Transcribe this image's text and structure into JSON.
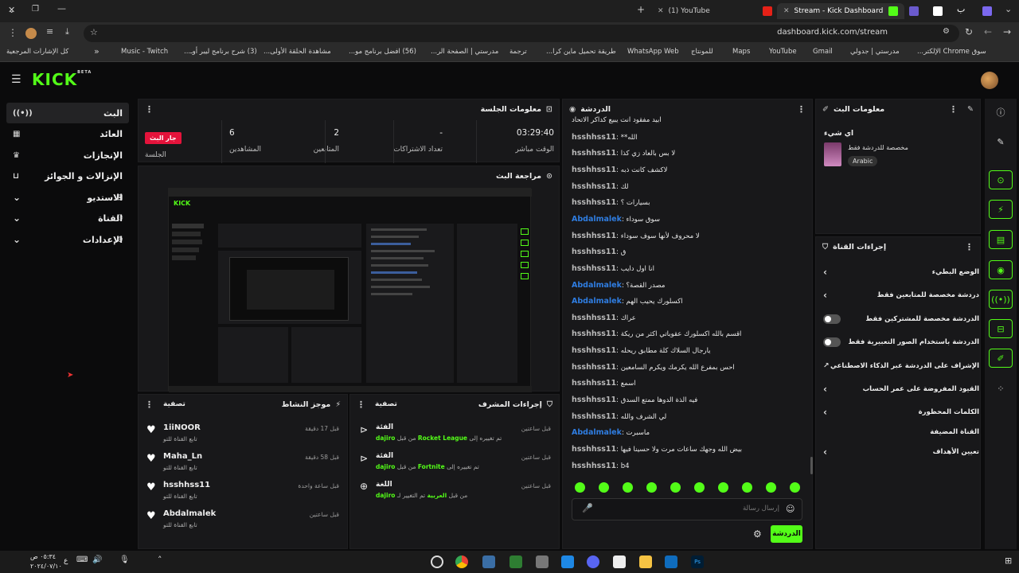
{
  "browser": {
    "tabs": [
      {
        "label": "(1) YouTube",
        "favicon": "youtube-icon"
      },
      {
        "label": "Stream - Kick Dashboard",
        "favicon": "kick-icon"
      }
    ],
    "url": "dashboard.kick.com/stream",
    "bookmarks": [
      "كل الإشارات المرجعية",
      "Music - Twitch",
      "(3) شرح برنامج ليبر أوـ...",
      "مشاهدة الحلقة الأولى...",
      "(56) افضل برنامج مو...",
      "مدرستي | الصفحة الر...",
      "ترجمة",
      "طريقة تحميل ماين كرا...",
      "WhatsApp Web",
      "للمونتاج",
      "Maps",
      "YouTube",
      "Gmail",
      "مدرستي | جدولي",
      "سوق Chrome الإلكتر..."
    ]
  },
  "brand": {
    "logo": "KICK",
    "beta": "BETA",
    "accent": "#53fc18"
  },
  "nav": [
    {
      "label": "البث",
      "icon": "broadcast-icon"
    },
    {
      "label": "العائد",
      "icon": "calendar-icon"
    },
    {
      "label": "الإنجازات",
      "icon": "trophy-icon"
    },
    {
      "label": "الإنزالات و الجوائز",
      "icon": "gift-icon"
    },
    {
      "label": "الاستديو",
      "icon": "studio-icon"
    },
    {
      "label": "القناة",
      "icon": "people-icon"
    },
    {
      "label": "الإعدادات",
      "icon": "gear-icon"
    }
  ],
  "session": {
    "title": "معلومات الجلسة",
    "live_badge": "جار البث",
    "stats": [
      {
        "value": "03:29:40",
        "label": "الوقت مباشر"
      },
      {
        "value": "-",
        "label": "تعداد الاشتراكات"
      },
      {
        "value": "2",
        "label": "المتابعين"
      },
      {
        "value": "6",
        "label": "المشاهدين"
      },
      {
        "value": "",
        "label": "الجلسة"
      }
    ]
  },
  "preview": {
    "title": "مراجعة البث"
  },
  "activity": {
    "title": "موجز النشاط",
    "filter": "تصفية",
    "items": [
      {
        "user": "1iiNOOR",
        "action": "تابع القناة للتو",
        "time": "قبل 17 دقيقة"
      },
      {
        "user": "Maha_Ln",
        "action": "تابع القناة للتو",
        "time": "قبل 58 دقيقة"
      },
      {
        "user": "hsshhss11",
        "action": "تابع القناة للتو",
        "time": "قبل ساعة واحدة"
      },
      {
        "user": "Abdalmalek",
        "action": "تابع القناة للتو",
        "time": "قبل ساعتين"
      }
    ]
  },
  "mod_actions": {
    "title": "إجراءات المشرف",
    "filter": "تصفية",
    "items": [
      {
        "heading": "الفئة",
        "by": "dajiro",
        "text": "من قبل",
        "change": "تم تغييره إلى",
        "target": "Rocket League",
        "time": "قبل ساعتين"
      },
      {
        "heading": "الفئة",
        "by": "dajiro",
        "text": "من قبل",
        "change": "تم تغييره إلى",
        "target": "Fortnite",
        "time": "قبل ساعتين"
      },
      {
        "heading": "اللغة",
        "by": "dajiro",
        "text": "من قبل",
        "change": "تم التغيير لـ",
        "target": "العربية",
        "time": "قبل ساعتين"
      }
    ]
  },
  "chat": {
    "title": "الدردشة",
    "placeholder": "إرسال رسالة",
    "send": "الدردشة",
    "messages": [
      {
        "user": "",
        "text": "ابيد مفقود انت يبيع كداكر الاتحاد"
      },
      {
        "user": "hsshhss11",
        "text": "**الله"
      },
      {
        "user": "hsshhss11",
        "text": "لا بس بالعاد زي كذا"
      },
      {
        "user": "hsshhss11",
        "text": "لاكشف كانت ذبه"
      },
      {
        "user": "hsshhss11",
        "text": "لك"
      },
      {
        "user": "hsshhss11",
        "text": "بسيارات ؟"
      },
      {
        "user": "Abdalmalek",
        "text": "سوق سوداء"
      },
      {
        "user": "hsshhss11",
        "text": "لا محروف لأنها سوف سوداء"
      },
      {
        "user": "hsshhss11",
        "text": "ق"
      },
      {
        "user": "hsshhss11",
        "text": "انا اول دايب"
      },
      {
        "user": "Abdalmalek",
        "text": "مصدر القصة؟"
      },
      {
        "user": "Abdalmalek",
        "text": "اكسلورك يحيب الهم"
      },
      {
        "user": "hsshhss11",
        "text": "عراك"
      },
      {
        "user": "hsshhss11",
        "text": "اقسم بالله اكسلورك عقوباتي اكثر من ريكة"
      },
      {
        "user": "hsshhss11",
        "text": "يارجال السلاك كلة مطابق ريحله"
      },
      {
        "user": "hsshhss11",
        "text": "احس بمفرع الله يكرمك ويكرم السامعين"
      },
      {
        "user": "hsshhss11",
        "text": "اسمع"
      },
      {
        "user": "hsshhss11",
        "text": "فيه الذة الدوها ممتع السدق"
      },
      {
        "user": "hsshhss11",
        "text": "لي الشرف والله"
      },
      {
        "user": "Abdalmalek",
        "text": "ماسبرت"
      },
      {
        "user": "hsshhss11",
        "text": "بيض الله وجهك ساعات مرت ولا حسينا فيها"
      },
      {
        "user": "hsshhss11",
        "text": "b4"
      }
    ]
  },
  "stream_info": {
    "title": "معلومات البث",
    "stream_title": "اي شيء",
    "category": "مخصصة للدردشة فقط",
    "language": "Arabic"
  },
  "channel_actions": {
    "title": "إجراءات القناة",
    "items": [
      {
        "label": "الوضع البطيء",
        "control": "chevron"
      },
      {
        "label": "دردشة مخصصة للمتابعين فقط",
        "control": "chevron"
      },
      {
        "label": "الدردشة مخصصة للمشتركين فقط",
        "control": "toggle"
      },
      {
        "label": "الدردشة باستخدام الصور التعبيرية فقط",
        "control": "toggle"
      },
      {
        "label": "الإشراف على الدردشة عبر الذكاء الاصطناعي",
        "control": "external"
      },
      {
        "label": "القيود المفروضة على عمر الحساب",
        "control": "chevron"
      },
      {
        "label": "الكلمات المحظورة",
        "control": "chevron"
      },
      {
        "label": "القناة المضيفة",
        "control": "none"
      },
      {
        "label": "تعيين الأهداف",
        "control": "chevron"
      }
    ]
  },
  "taskbar": {
    "time": "٠٥:٣٤ ص",
    "date": "٢٠٢٤/٠٧/١٠",
    "lang": "ع"
  }
}
